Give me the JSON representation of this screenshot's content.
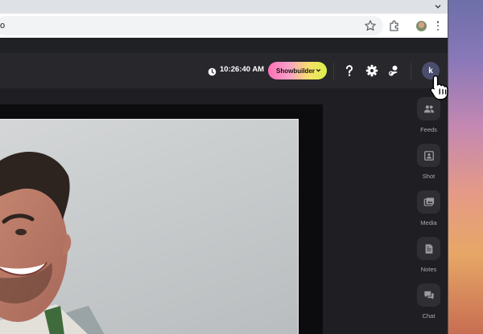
{
  "browser": {
    "url_fragment": "o"
  },
  "app": {
    "clock": {
      "time": "10:26:40 AM"
    },
    "showbuilder_label": "Showbuilder",
    "avatar_initial": "k",
    "sidebar": [
      {
        "label": "Feeds",
        "icon": "feeds-icon"
      },
      {
        "label": "Shot",
        "icon": "shot-icon"
      },
      {
        "label": "Media",
        "icon": "media-icon"
      },
      {
        "label": "Notes",
        "icon": "notes-icon"
      },
      {
        "label": "Chat",
        "icon": "chat-icon"
      }
    ]
  },
  "colors": {
    "app_bg": "#1f1f23",
    "header_bg": "#27272c",
    "side_button_bg": "#2e2e33",
    "avatar_bg": "#4a4d6b",
    "showbuilder_gradient_start": "#ff6fb5",
    "showbuilder_gradient_end": "#d8f04a"
  }
}
